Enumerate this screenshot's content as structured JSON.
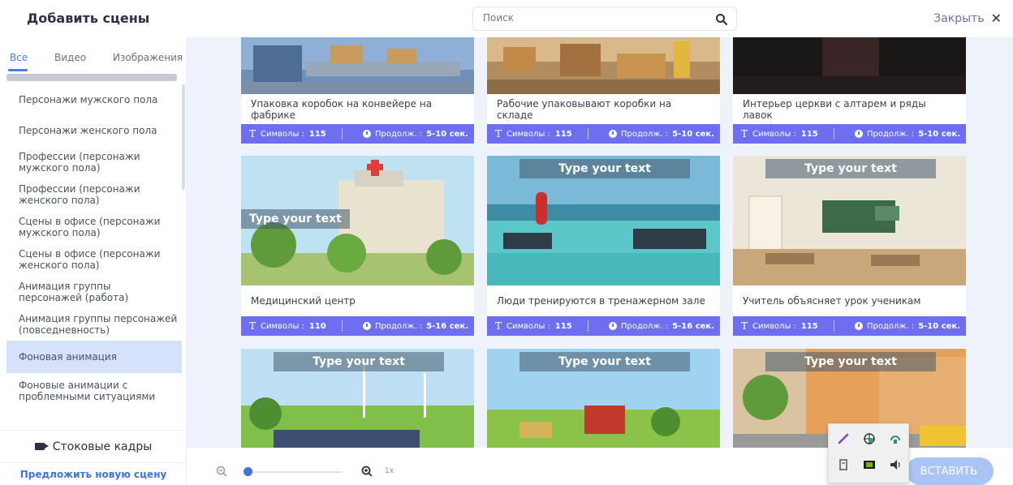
{
  "header": {
    "title": "Добавить сцены",
    "search_placeholder": "Поиск",
    "close_label": "Закрыть",
    "close_glyph": "✕"
  },
  "sidebar": {
    "tabs": [
      {
        "label": "Все",
        "active": true
      },
      {
        "label": "Видео",
        "active": false
      },
      {
        "label": "Изображения",
        "active": false
      }
    ],
    "categories": [
      {
        "label": "Персонажи мужского пола"
      },
      {
        "label": "Персонажи женского пола"
      },
      {
        "label": "Профессии (персонажи мужского пола)"
      },
      {
        "label": "Профессии (персонажи женского пола)"
      },
      {
        "label": "Сцены в офисе (персонажи мужского пола)"
      },
      {
        "label": "Сцены в офисе (персонажи женского пола)"
      },
      {
        "label": "Анимация группы персонажей (работа)"
      },
      {
        "label": "Анимация группы персонажей (повседневность)"
      },
      {
        "label": "Фоновая анимация",
        "active": true
      },
      {
        "label": "Фоновые анимации с проблемными ситуациями"
      }
    ],
    "stock_label": "Стоковые кадры",
    "suggest_label": "Предложить новую сцену"
  },
  "meta_labels": {
    "chars": "Символы :",
    "duration": "Продолж. :",
    "t_glyph": "T"
  },
  "scenes": [
    {
      "caption": "Упаковка коробок на конвейере на фабрике",
      "chars": "115",
      "duration": "5-10 сек.",
      "overlay": ""
    },
    {
      "caption": "Рабочие упаковывают коробки на складе",
      "chars": "115",
      "duration": "5-10 сек.",
      "overlay": ""
    },
    {
      "caption": "Интерьер церкви с алтарем и ряды лавок",
      "chars": "115",
      "duration": "5-10 сек.",
      "overlay": ""
    },
    {
      "caption": "Медицинский центр",
      "chars": "110",
      "duration": "5-16 сек.",
      "overlay": "Type your text"
    },
    {
      "caption": "Люди тренируются в тренажерном зале",
      "chars": "115",
      "duration": "5-16 сек.",
      "overlay": "Type your text"
    },
    {
      "caption": "Учитель объясняет урок ученикам",
      "chars": "115",
      "duration": "5-10 сек.",
      "overlay": "Type your text"
    },
    {
      "caption": "",
      "overlay": "Type your text"
    },
    {
      "caption": "",
      "overlay": "Type your text"
    },
    {
      "caption": "",
      "overlay": "Type your text"
    }
  ],
  "footer": {
    "zoom_level": "1x",
    "zoom_value_fraction": 0.0,
    "insert_label": "ВСТАВИТЬ"
  },
  "colors": {
    "accent": "#3f73e0",
    "meta_bar": "#6e6ef0",
    "active_category": "#d6e2fb",
    "main_bg": "#eef2fb"
  }
}
